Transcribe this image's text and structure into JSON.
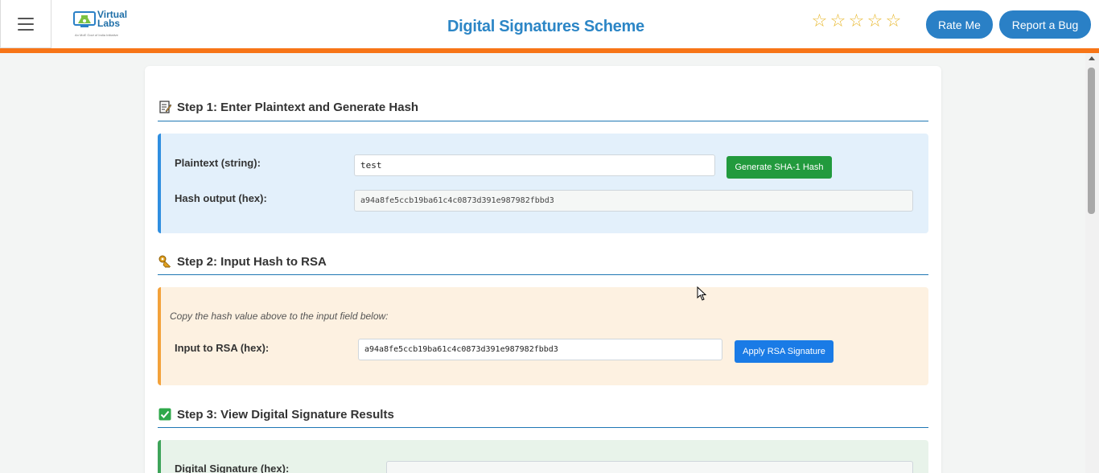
{
  "header": {
    "title": "Digital Signatures Scheme",
    "logo_text": "Virtual\nLabs",
    "logo_subtitle": "An MoE Govt of India Initiative",
    "stars": [
      "☆",
      "☆",
      "☆",
      "☆",
      "☆"
    ],
    "rate_label": "Rate Me",
    "bug_label": "Report a Bug"
  },
  "step1": {
    "icon": "memo-icon",
    "heading": "Step 1: Enter Plaintext and Generate Hash",
    "plaintext_label": "Plaintext (string):",
    "plaintext_value": "test",
    "generate_label": "Generate SHA-1 Hash",
    "hash_label": "Hash output (hex):",
    "hash_value": "a94a8fe5ccb19ba61c4c0873d391e987982fbbd3"
  },
  "step2": {
    "icon": "key-icon",
    "heading": "Step 2: Input Hash to RSA",
    "note": "Copy the hash value above to the input field below:",
    "rsa_label": "Input to RSA (hex):",
    "rsa_value": "a94a8fe5ccb19ba61c4c0873d391e987982fbbd3",
    "apply_label": "Apply RSA Signature"
  },
  "step3": {
    "icon": "check-icon",
    "heading": "Step 3: View Digital Signature Results",
    "signature_label": "Digital Signature (hex):"
  },
  "colors": {
    "accent_orange": "#f77517",
    "brand_blue": "#2a80c6",
    "green_button": "#229a3d",
    "blue_button": "#1a7be6"
  }
}
